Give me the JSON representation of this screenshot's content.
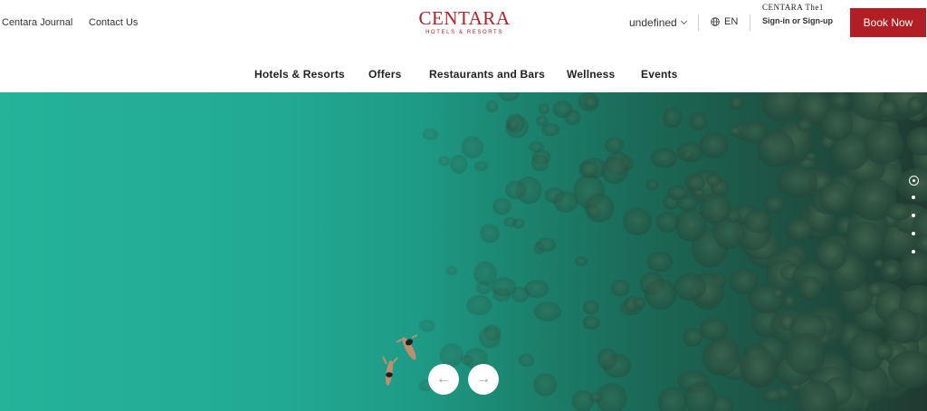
{
  "topbar": {
    "journal_label": "Centara Journal",
    "contact_label": "Contact Us",
    "logo": {
      "word": "CENTARA",
      "tagline": "HOTELS & RESORTS"
    },
    "user_select_value": "undefined",
    "language": "EN",
    "account": {
      "brand": "CENTARA The1",
      "signin_label": "Sign-in or Sign-up"
    },
    "book_label": "Book Now"
  },
  "nav": {
    "items": [
      {
        "label": "Hotels & Resorts"
      },
      {
        "label": "Offers"
      },
      {
        "label": "Restaurants and Bars"
      },
      {
        "label": "Wellness"
      },
      {
        "label": "Events"
      }
    ]
  },
  "hero": {
    "image": "aerial-sea-swimmers",
    "slides_count": 5,
    "active_slide": 1,
    "prev_icon": "←",
    "next_icon": "→"
  },
  "colors": {
    "brand_red": "#b11f24",
    "logo_red": "#b0232a",
    "sea_light": "#25b39a",
    "sea_dark": "#223f36"
  }
}
